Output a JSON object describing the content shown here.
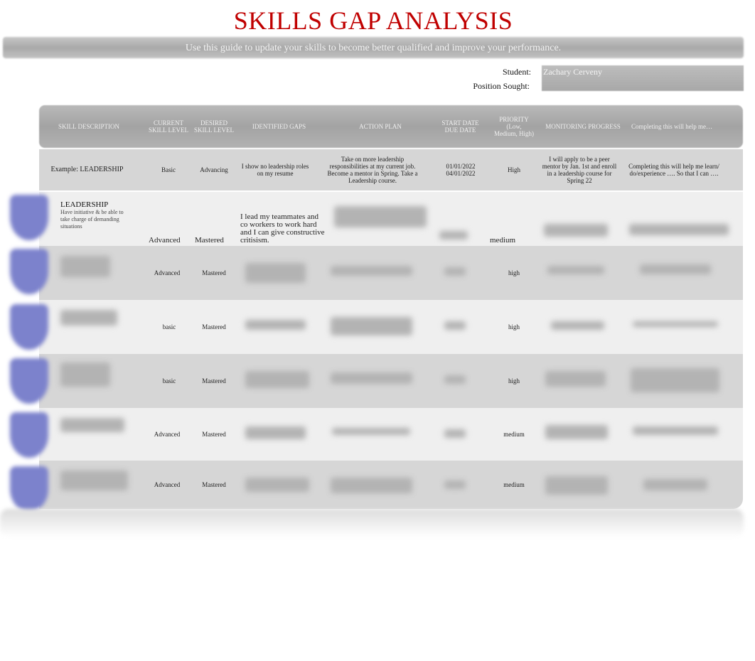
{
  "header": {
    "title": "SKILLS GAP ANALYSIS",
    "subtitle": "Use this guide to update your skills to become better qualified and improve your performance."
  },
  "meta": {
    "student_label": "Student:",
    "student_value": "Zachary Cerveny",
    "position_label": "Position Sought:",
    "position_value": ""
  },
  "colors": {
    "title": "#c00000",
    "header_bar": "#a9a9a9",
    "row_dark": "#d6d6d6",
    "row_light": "#efefef",
    "icon": "#7c82cc"
  },
  "table": {
    "columns": [
      "SKILL DESCRIPTION",
      "CURRENT SKILL LEVEL",
      "DESIRED SKILL LEVEL",
      "IDENTIFIED GAPS",
      "ACTION PLAN",
      "START DATE DUE DATE",
      "PRIORITY (Low, Medium, High)",
      "MONITORING PROGRESS",
      "Completing this will help me…"
    ],
    "example": {
      "skill": "Example: LEADERSHIP",
      "current": "Basic",
      "desired": "Advancing",
      "gaps": "I show no leadership roles on my resume",
      "action": "Take on more leadership responsibilities at my current job. Become a mentor in Spring. Take a Leadership course.",
      "dates": "01/01/2022 04/01/2022",
      "priority": "High",
      "monitoring": "I will apply to be a peer mentor by Jan. 1st and enroll in a leadership course for Spring 22",
      "completing": "Completing this will help me learn/ do/experience …. So that I can …."
    },
    "rows": [
      {
        "skill_title": "LEADERSHIP",
        "skill_desc": "Have initiative & be able to take charge of demanding situations",
        "current": "Advanced",
        "desired": "Mastered",
        "gaps": "I lead my teammates and co workers to work hard and I can give constructive critisism.",
        "priority": "medium"
      },
      {
        "current": "Advanced",
        "desired": "Mastered",
        "priority": "high"
      },
      {
        "current": "basic",
        "desired": "Mastered",
        "priority": "high"
      },
      {
        "current": "basic",
        "desired": "Mastered",
        "priority": "high"
      },
      {
        "current": "Advanced",
        "desired": "Mastered",
        "priority": "medium"
      },
      {
        "current": "Advanced",
        "desired": "Mastered",
        "priority": "medium"
      }
    ]
  }
}
